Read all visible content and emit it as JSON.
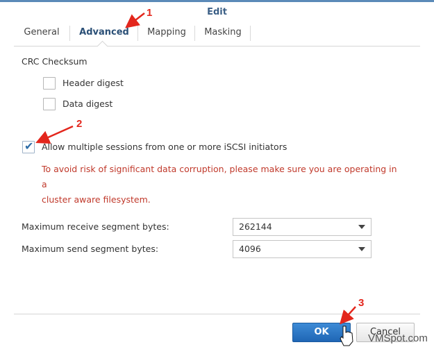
{
  "window": {
    "title": "Edit"
  },
  "tabs": [
    {
      "label": "General"
    },
    {
      "label": "Advanced"
    },
    {
      "label": "Mapping"
    },
    {
      "label": "Masking"
    }
  ],
  "crc": {
    "section_label": "CRC Checksum",
    "header_digest": {
      "label": "Header digest",
      "checked": false
    },
    "data_digest": {
      "label": "Data digest",
      "checked": false
    }
  },
  "multi_session": {
    "label": "Allow multiple sessions from one or more iSCSI initiators",
    "checked": true,
    "warning_line1": "To avoid risk of significant data corruption, please make sure you are operating in a",
    "warning_line2": "cluster aware filesystem."
  },
  "segments": {
    "receive_label": "Maximum receive segment bytes:",
    "receive_value": "262144",
    "send_label": "Maximum send segment bytes:",
    "send_value": "4096"
  },
  "buttons": {
    "ok": "OK",
    "cancel": "Cancel"
  },
  "annotations": {
    "one": "1",
    "two": "2",
    "three": "3",
    "accent_color": "#e3261c"
  },
  "watermark": "VMSpot.com"
}
